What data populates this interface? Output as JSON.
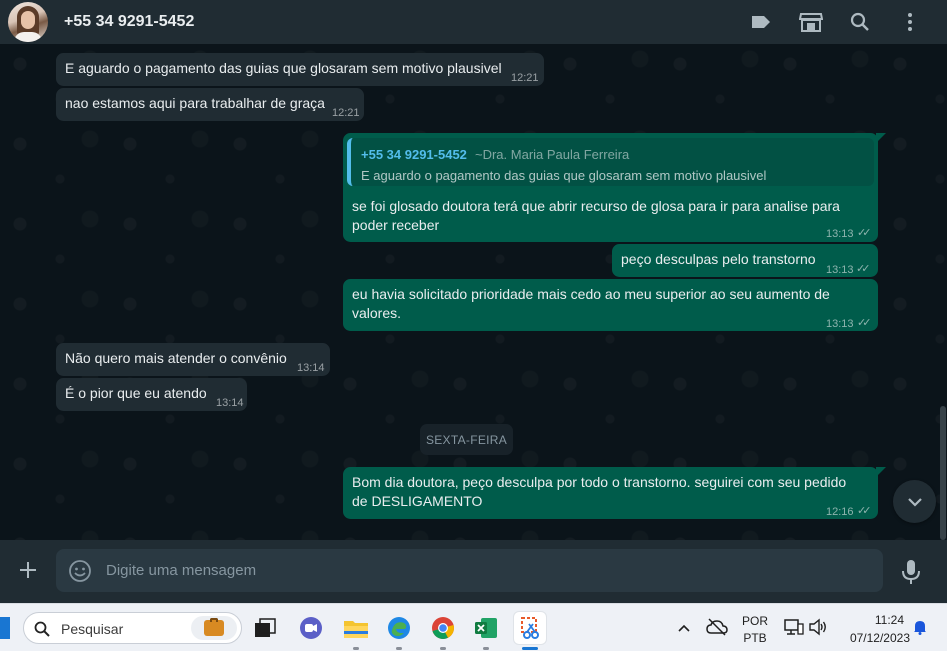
{
  "header": {
    "contact": "+55 34 9291-5452",
    "icons": [
      "label-icon",
      "catalog-icon",
      "search-icon",
      "menu-icon"
    ]
  },
  "messages": [
    {
      "dir": "in",
      "text": "E aguardo o pagamento das guias que glosaram sem motivo plausivel",
      "time": "12:21"
    },
    {
      "dir": "in",
      "text": "nao estamos aqui para trabalhar de graça",
      "time": "12:21"
    },
    {
      "dir": "out",
      "quote": {
        "name": "+55 34 9291-5452",
        "pushname": "~Dra. Maria Paula Ferreira",
        "text": "E aguardo o pagamento das guias que glosaram sem motivo plausivel"
      },
      "text": "se foi glosado doutora terá que abrir recurso de glosa para ir para analise para poder receber",
      "time": "13:13",
      "status": "read"
    },
    {
      "dir": "out",
      "text": "peço desculpas pelo transtorno",
      "time": "13:13",
      "status": "read"
    },
    {
      "dir": "out",
      "text": "eu havia solicitado prioridade mais cedo ao meu superior ao seu aumento de valores.",
      "time": "13:13",
      "status": "read"
    },
    {
      "dir": "in",
      "text": "Não quero mais atender o convênio",
      "time": "13:14"
    },
    {
      "dir": "in",
      "text": "É o pior que eu atendo",
      "time": "13:14"
    },
    {
      "dir": "out",
      "text": "Bom dia doutora, peço desculpa por todo o transtorno. seguirei com seu pedido de DESLIGAMENTO",
      "time": "12:16",
      "status": "read"
    }
  ],
  "day_separator": "SEXTA-FEIRA",
  "composer": {
    "placeholder": "Digite uma mensagem"
  },
  "taskbar": {
    "search_placeholder": "Pesquisar",
    "language_line1": "POR",
    "language_line2": "PTB",
    "clock_time": "11:24",
    "clock_date": "07/12/2023"
  },
  "colors": {
    "incoming_bubble": "#202c33",
    "outgoing_bubble": "#005c4b",
    "chat_background": "#0b141a",
    "header_background": "#202c33",
    "quote_accent": "#53bdeb",
    "read_ticks": "#8696a0"
  }
}
